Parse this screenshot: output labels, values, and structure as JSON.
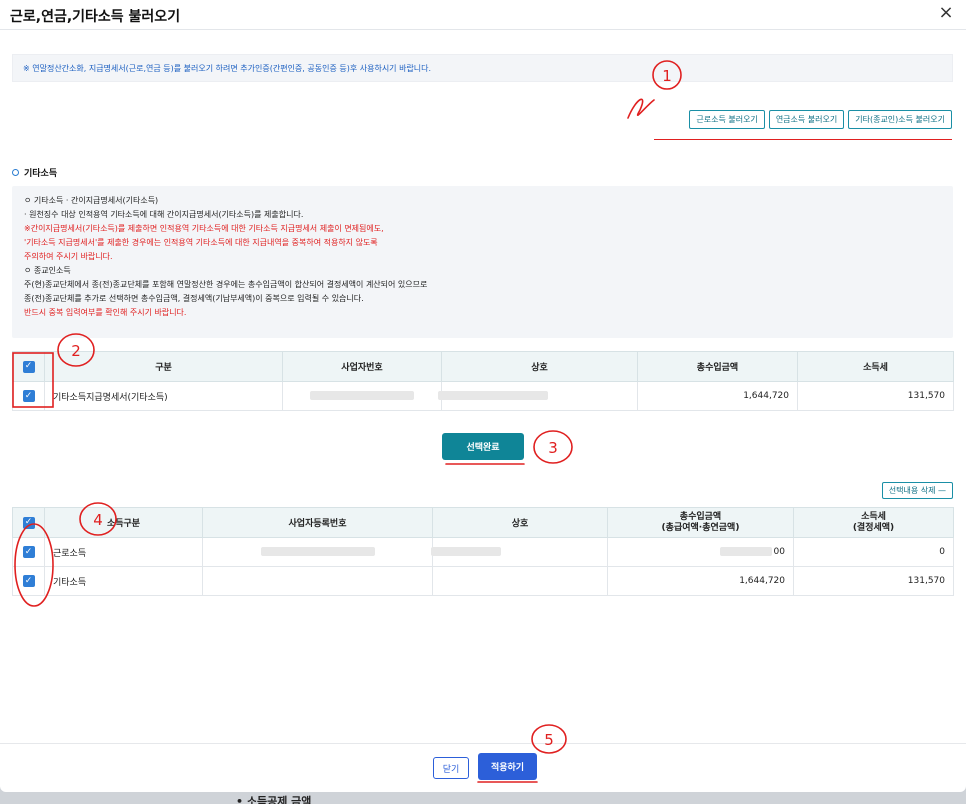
{
  "modal": {
    "title": "근로,연금,기타소득 불러오기",
    "close_icon": "×"
  },
  "notice": "※ 연말정산간소화, 지급명세서(근로,연금 등)를 불러오기 하려면 추가인증(간편인증, 공동인증 등)후 사용하시기 바랍니다.",
  "load_buttons": {
    "earned": "근로소득 불러오기",
    "pension": "연금소득 불러오기",
    "other": "기타(종교인)소득 불러오기"
  },
  "section": {
    "title": "기타소득"
  },
  "info": {
    "l1": "ㅇ 기타소득 · 간이지급명세서(기타소득)",
    "l2": "· 원천징수 대상 인적용역 기타소득에 대해 간이지급명세서(기타소득)를 제출합니다.",
    "l3": "※간이지급명세서(기타소득)를 제출하면 인적용역 기타소득에 대한 기타소득 지급명세서 제출이 면제됨에도,",
    "l4": "  '기타소득 지급명세서'를 제출한 경우에는 인적용역 기타소득에 대한 지급내역을 중복하여 적용하지 않도록",
    "l5": "  주의하여 주시기 바랍니다.",
    "l6": "ㅇ 종교인소득",
    "l7": "주(현)종교단체에서 종(전)종교단체를 포함해 연말정산한 경우에는 총수입금액이 합산되어 결정세액이 계산되어 있으므로",
    "l8": "종(전)종교단체를 추가로 선택하면 총수입금액, 결정세액(기납부세액)이 중복으로 입력될 수 있습니다.",
    "l9": "반드시 중복 입력여부를 확인해 주시기 바랍니다."
  },
  "table1": {
    "headers": [
      "구분",
      "사업자번호",
      "상호",
      "총수입금액",
      "소득세"
    ],
    "row": {
      "type": "기타소득지급명세서(기타소득)",
      "amount": "1,644,720",
      "tax": "131,570"
    }
  },
  "select_done": "선택완료",
  "delete_selected": "선택내용 삭제 —",
  "table2": {
    "headers": {
      "type": "소득구분",
      "biz": "사업자등록번호",
      "name": "상호",
      "amount_l1": "총수입금액",
      "amount_l2": "(총급여액·총연금액)",
      "tax_l1": "소득세",
      "tax_l2": "(결정세액)"
    },
    "rows": [
      {
        "type": "근로소득",
        "amount": "00",
        "tax": "0"
      },
      {
        "type": "기타소득",
        "amount": "1,644,720",
        "tax": "131,570"
      }
    ]
  },
  "footer": {
    "close": "닫기",
    "apply": "적용하기"
  },
  "backdrop_text": "• 소득공제 금액",
  "annotations": [
    "1",
    "2",
    "3",
    "4",
    "5"
  ],
  "colors": {
    "primary": "#0f8597",
    "blue": "#2c5fd9",
    "checkbox": "#2f7ed6",
    "red": "#e02020"
  }
}
